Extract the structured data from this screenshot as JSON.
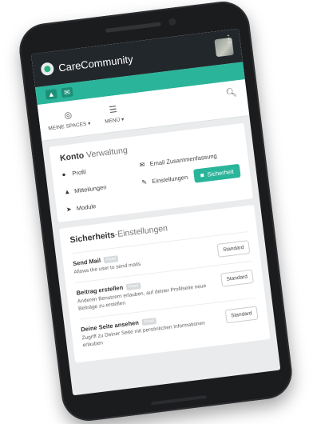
{
  "app": {
    "title": "CareCommunity"
  },
  "nav": {
    "spaces_label": "MEINE SPACES ▾",
    "menu_label": "MENÜ ▾"
  },
  "konto": {
    "title_bold": "Konto",
    "title_rest": "Verwaltung",
    "profil": "Profil",
    "email": "Email Zusammenfassung",
    "mitteilungen": "Mitteilungen",
    "einstellungen": "Einstellungen",
    "sicherheit": "Sicherheit",
    "module": "Module"
  },
  "sicherheit": {
    "title_bold": "Sicherheits",
    "title_rest": "-Einstellungen",
    "items": [
      {
        "title": "Send Mail",
        "badge": "Fixed",
        "desc": "Allows the user to send mails",
        "button": "Standard"
      },
      {
        "title": "Beitrag erstellen",
        "badge": "Fixed",
        "desc": "Anderen Benutzern erlauben, auf deiner Profilseite neue Beiträge zu erstellen",
        "button": "Standard"
      },
      {
        "title": "Deine Seite ansehen",
        "badge": "Fixed",
        "desc": "Zugriff zu Deiner Seite mit persönlichen Informationen erlauben",
        "button": "Standard"
      }
    ]
  },
  "colors": {
    "accent": "#2ab59b",
    "topbar": "#22272b"
  }
}
